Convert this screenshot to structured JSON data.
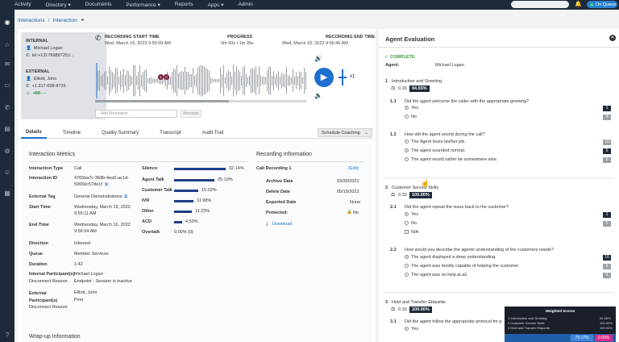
{
  "topnav": {
    "items": [
      "Activity",
      "Directory ▾",
      "Documents",
      "Performance ▾",
      "Reports",
      "Apps ▾",
      "Admin"
    ],
    "queue_label": "On Queue"
  },
  "breadcrumb": {
    "parent": "Interactions",
    "sep": "/",
    "current": "Interaction"
  },
  "internal": {
    "label": "INTERNAL",
    "name": "Michael Logan",
    "phone": "tel:+13176988725;t..."
  },
  "external": {
    "label": "EXTERNAL",
    "name": "Elliott, John",
    "phone": "+1 317-698-8725",
    "score": "+60 - -"
  },
  "recording": {
    "start_label": "RECORDING START TIME",
    "start_value": "Wed, March 16, 2022 9:55:09 AM",
    "progress_label": "PROGRESS",
    "progress_value": "0m 00s / 1m 35s",
    "end_label": "RECORDING END TIME",
    "end_value": "Wed, March 16, 2022 9:56:45 AM",
    "speed": "x1",
    "markers": [
      "1",
      "2"
    ]
  },
  "annotation": {
    "placeholder": "Add Annotation",
    "button": "Annotate"
  },
  "tabs": [
    "Details",
    "Timeline",
    "Quality Summary",
    "Transcript",
    "Audit Trail"
  ],
  "schedule_button": "Schedule Coaching",
  "metrics": {
    "title": "Interaction Metrics",
    "rows": [
      {
        "label": "Interaction Type",
        "value": "Call"
      },
      {
        "label": "Interaction ID",
        "value": "4765ba7c-368b-4ea5-ac1d-",
        "value2": "59650c57de1f"
      },
      {
        "label": "External Tag",
        "value": "General Demonstrations"
      },
      {
        "label": "Start Time",
        "value": "Wednesday, March 16, 2022",
        "value2": "9:55:11 AM"
      },
      {
        "label": "End Time",
        "value": "Wednesday, March 16, 2022",
        "value2": "9:56:54 AM"
      },
      {
        "label": "Direction",
        "value": "Inbound"
      },
      {
        "label": "Queue",
        "value": "Member Services"
      },
      {
        "label": "Duration",
        "value": "1:42"
      }
    ],
    "internal_participant_label": "Internal Participant(s)",
    "internal_participant_value": "Michael Logan",
    "disconnect_label_1": "Disconnect Reason",
    "disconnect_value_1": "Endpoint - Session is inactive",
    "external_participant_label": "External Participant(s)",
    "external_participant_value": "Elliott, John",
    "disconnect_label_2": "Disconnect Reason",
    "disconnect_value_2": "Peer"
  },
  "stats": [
    {
      "label": "Silence",
      "value": "32.14%",
      "fill": 0.6
    },
    {
      "label": "Agent Talk",
      "value": "25.10%",
      "fill": 0.47
    },
    {
      "label": "Customer Talk",
      "value": "15.02%",
      "fill": 0.3
    },
    {
      "label": "IVR",
      "value": "11.98%",
      "fill": 0.24
    },
    {
      "label": "Other",
      "value": "11.23%",
      "fill": 0.22
    },
    {
      "label": "ACD",
      "value": "4.53%",
      "fill": 0.09
    },
    {
      "label": "Overtalk",
      "value": "0.00% (0)",
      "fill": 0
    }
  ],
  "recinfo": {
    "title": "Recording Information",
    "call": "Call Recording 1",
    "edit": "(Edit)",
    "archive_label": "Archive Date",
    "archive_value": "03/30/2022",
    "delete_label": "Delete Date",
    "delete_value": "05/15/2022",
    "exported_label": "Exported Date",
    "exported_value": "None",
    "protected_label": "Protected:",
    "protected_value": "No",
    "download": "Download"
  },
  "wrapup": "Wrap-up Information",
  "evaluation": {
    "title": "Agent Evaluation",
    "status": "COMPLETE",
    "agent_label": "Agent:",
    "agent_value": "Michael Logan",
    "sections": [
      {
        "num": "1",
        "title": "Introduction and Greeting",
        "weight": "0.33",
        "score": "94.55%"
      },
      {
        "num": "2",
        "title": "Customer Service Skills",
        "weight": "0.33",
        "score": "100.00%"
      },
      {
        "num": "3",
        "title": "Hold and Transfer Etiquette",
        "weight": "0.33",
        "score": "100.00%"
      }
    ],
    "q11": {
      "num": "1.1",
      "text": "Did the agent welcome the caller with the appropriate greeting?",
      "opts": [
        "Yes",
        "No"
      ],
      "scores": [
        "1",
        "0"
      ]
    },
    "q12": {
      "num": "1.2",
      "text": "How did the agent sound during the call?",
      "opts": [
        "The Agent loves his/her job.",
        "The agent sounded normal.",
        "The agent would rather be somewhere else."
      ],
      "scores": [
        "10",
        "5",
        "0"
      ]
    },
    "q21": {
      "num": "2.1",
      "text": "Did the agent repeat the issue back to the customer?",
      "opts": [
        "Yes",
        "No",
        "N/A"
      ],
      "scores": [
        "1",
        "0"
      ]
    },
    "q22": {
      "num": "2.2",
      "text": "How would you describe the agents understanding of the customers needs?",
      "opts": [
        "The agent displayed a deep understanding.",
        "The agent was mostly capable of helping the customer.",
        "The agent was no help at all."
      ],
      "scores": [
        "10",
        "5",
        "0"
      ]
    },
    "q31": {
      "num": "3.1",
      "text": "Did the agent follow the appropriate protocol for p",
      "opts": [
        "Yes"
      ]
    }
  },
  "weighted": {
    "title": "Weighted Scores",
    "rows": [
      {
        "label": "1 Introduction and Greeting",
        "value": "94.55%"
      },
      {
        "label": "2 Customer Service Skills",
        "value": "100.00%"
      },
      {
        "label": "3 Hold and Transfer Etiquette",
        "value": "100.00%"
      }
    ],
    "total": "79.17%",
    "critical": "0.00%"
  }
}
